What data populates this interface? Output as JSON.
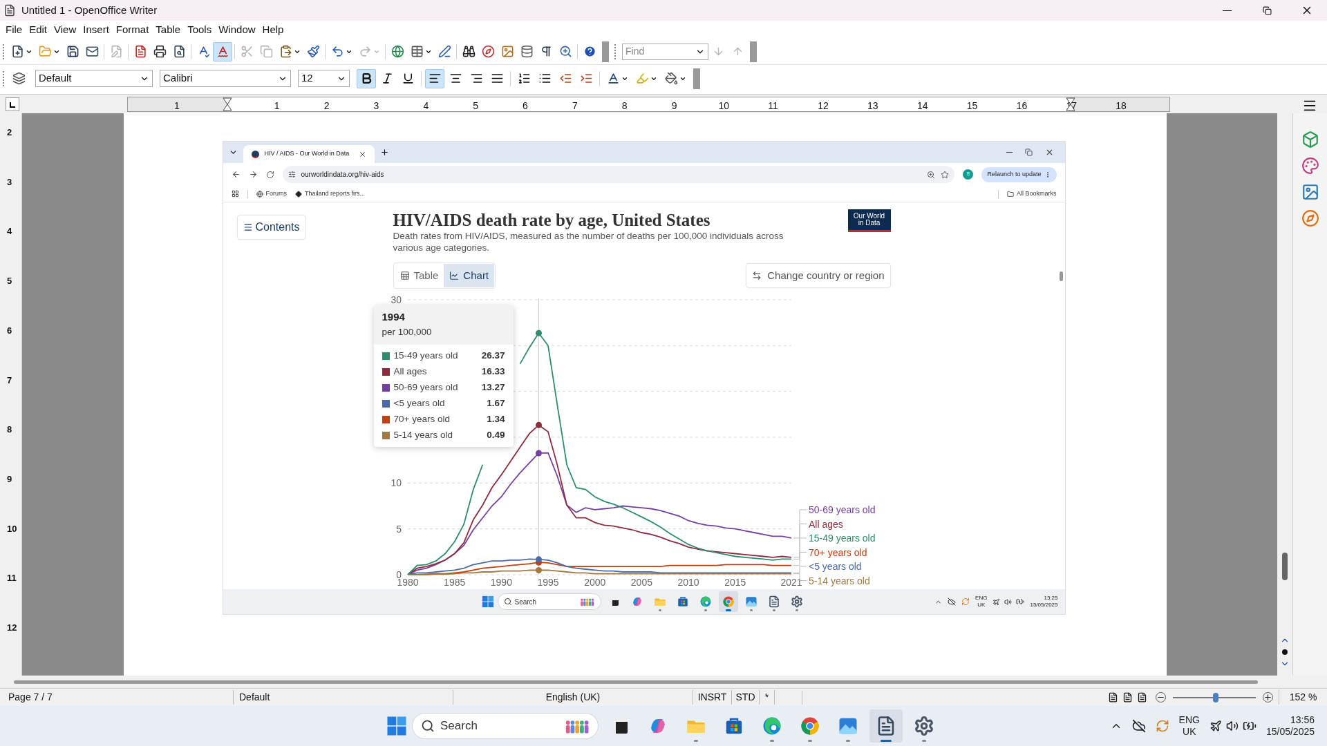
{
  "window": {
    "title": "Untitled 1 - OpenOffice Writer"
  },
  "menu": [
    "File",
    "Edit",
    "View",
    "Insert",
    "Format",
    "Table",
    "Tools",
    "Window",
    "Help"
  ],
  "find": {
    "placeholder": "Find"
  },
  "toggles": {
    "auto_spellcheck": true,
    "bold": true,
    "italic": false,
    "underline": false,
    "align_left": true,
    "align_center": false,
    "align_right": false,
    "justify": false
  },
  "disabled": {
    "edit_file": true,
    "cut": true,
    "copy": true,
    "redo": true,
    "find_next": true,
    "find_previous": true
  },
  "formatting": {
    "paragraph_style": "Default",
    "font_name": "Calibri",
    "font_size": "12"
  },
  "ruler": {
    "left_label": "1",
    "labels": [
      "1",
      "2",
      "3",
      "4",
      "5",
      "6",
      "7",
      "8",
      "9",
      "10",
      "11",
      "12",
      "13",
      "14",
      "15",
      "16",
      "17",
      "18"
    ]
  },
  "vertical_ruler": [
    "2",
    "3",
    "4",
    "5",
    "6",
    "7",
    "8",
    "9",
    "10",
    "11",
    "12"
  ],
  "browser": {
    "tab_title": "HIV / AIDS - Our World in Data",
    "url": "ourworldindata.org/hiv-aids",
    "profile": "S",
    "relaunch": "Relaunch to update",
    "bookmarks": [
      "Forums",
      "Thailand reports firs..."
    ],
    "all_bookmarks": "All Bookmarks"
  },
  "article": {
    "contents": "Contents",
    "title": "HIV/AIDS death rate by age, United States",
    "description": "Death rates from HIV/AIDS, measured as the number of deaths per 100,000 individuals across various age categories.",
    "logo": [
      "Our World",
      "in Data"
    ],
    "view_tabs": [
      {
        "label": "Table",
        "selected": false
      },
      {
        "label": "Chart",
        "selected": true
      }
    ],
    "change_country": "Change country or region",
    "tooltip": {
      "year": "1994",
      "unit": "per 100,000",
      "rows": [
        {
          "label": "15-49 years old",
          "value": "26.37",
          "color": "#2e8b6e"
        },
        {
          "label": "All ages",
          "value": "16.33",
          "color": "#8c2b3e"
        },
        {
          "label": "50-69 years old",
          "value": "13.27",
          "color": "#7440a0"
        },
        {
          "label": "<5 years old",
          "value": "1.67",
          "color": "#4a6aa8"
        },
        {
          "label": "70+ years old",
          "value": "1.34",
          "color": "#c0400f"
        },
        {
          "label": "5-14 years old",
          "value": "0.49",
          "color": "#a07840"
        }
      ]
    },
    "chart_data": {
      "type": "line",
      "xlim": [
        1980,
        2021
      ],
      "ylim": [
        0,
        30
      ],
      "xticks": [
        1980,
        1985,
        1990,
        1995,
        2000,
        2005,
        2010,
        2015,
        2021
      ],
      "yticks": [
        0,
        5,
        10,
        30
      ],
      "ref_lines": [
        {
          "axis": "x",
          "value": 1994
        }
      ],
      "x": [
        1980,
        1981,
        1982,
        1983,
        1984,
        1985,
        1986,
        1987,
        1988,
        1989,
        1990,
        1991,
        1992,
        1993,
        1994,
        1995,
        1996,
        1997,
        1998,
        1999,
        2000,
        2001,
        2002,
        2003,
        2004,
        2005,
        2006,
        2007,
        2008,
        2009,
        2010,
        2011,
        2012,
        2013,
        2014,
        2015,
        2016,
        2017,
        2018,
        2019,
        2020,
        2021
      ],
      "series": [
        {
          "name": "50-69 years old",
          "color": "#7440a0",
          "values": [
            0,
            0.5,
            0.7,
            1.1,
            1.6,
            2.3,
            3.2,
            4.9,
            6.2,
            7.5,
            8.5,
            9.9,
            11.1,
            12.2,
            13.27,
            13.3,
            10.7,
            7.6,
            6.8,
            7.3,
            7.1,
            7.2,
            7.3,
            7.5,
            7.4,
            7.3,
            7.2,
            7.0,
            6.7,
            6.4,
            5.9,
            5.6,
            5.4,
            5.3,
            5.1,
            5.0,
            4.8,
            4.6,
            4.4,
            4.2,
            4.2,
            4.0
          ]
        },
        {
          "name": "All ages",
          "color": "#8c2b3e",
          "values": [
            0,
            0.7,
            0.9,
            1.2,
            1.6,
            2.3,
            3.5,
            6.0,
            7.6,
            9.5,
            10.9,
            12.4,
            13.9,
            15.4,
            16.33,
            15.6,
            11.9,
            7.6,
            6.2,
            6.2,
            5.7,
            5.4,
            5.3,
            5.1,
            4.9,
            4.6,
            4.4,
            4.1,
            3.7,
            3.4,
            3.0,
            2.8,
            2.6,
            2.5,
            2.4,
            2.3,
            2.2,
            2.1,
            2.0,
            1.9,
            2.0,
            1.9
          ]
        },
        {
          "name": "15-49 years old",
          "color": "#2e8b6e",
          "values": [
            0,
            1.0,
            1.1,
            1.5,
            2.3,
            3.6,
            5.5,
            9.3,
            12.0,
            null,
            null,
            null,
            23.0,
            24.8,
            26.37,
            25.0,
            18.4,
            12.0,
            9.5,
            9.3,
            8.5,
            8.0,
            7.7,
            7.3,
            6.8,
            6.3,
            5.8,
            5.2,
            4.5,
            3.9,
            3.3,
            2.9,
            2.6,
            2.4,
            2.2,
            2.0,
            1.9,
            1.8,
            1.7,
            1.6,
            1.7,
            1.7
          ]
        },
        {
          "name": "70+ years old",
          "color": "#c0400f",
          "values": [
            0,
            0,
            0.05,
            0.1,
            0.1,
            0.2,
            0.3,
            0.5,
            0.7,
            0.8,
            0.9,
            1.0,
            1.1,
            1.2,
            1.34,
            1.3,
            1.1,
            0.9,
            0.9,
            0.9,
            0.9,
            0.9,
            0.9,
            0.9,
            0.9,
            0.9,
            0.9,
            0.9,
            1.0,
            1.0,
            1.0,
            1.0,
            1.0,
            1.0,
            1.1,
            1.1,
            1.1,
            1.1,
            1.1,
            1.0,
            1.0,
            1.0
          ]
        },
        {
          "name": "<5 years old",
          "color": "#4a6aa8",
          "values": [
            0,
            0.2,
            0.2,
            0.3,
            0.4,
            0.5,
            0.7,
            1.1,
            1.3,
            1.5,
            1.5,
            1.6,
            1.6,
            1.7,
            1.67,
            1.6,
            1.3,
            0.9,
            0.7,
            0.6,
            0.5,
            0.4,
            0.4,
            0.3,
            0.3,
            0.3,
            0.3,
            0.2,
            0.2,
            0.2,
            0.2,
            0.2,
            0.2,
            0.2,
            0.2,
            0.2,
            0.2,
            0.2,
            0.2,
            0.2,
            0.2,
            0.2
          ]
        },
        {
          "name": "5-14 years old",
          "color": "#a07840",
          "values": [
            0,
            0,
            0,
            0.05,
            0.05,
            0.1,
            0.2,
            0.2,
            0.3,
            0.3,
            0.4,
            0.4,
            0.4,
            0.5,
            0.49,
            0.5,
            0.4,
            0.3,
            0.2,
            0.2,
            0.1,
            0.1,
            0.1,
            0.1,
            0.1,
            0.1,
            0.1,
            0.1,
            0.1,
            0.1,
            0.1,
            0.1,
            0.1,
            0.1,
            0.1,
            0.1,
            0.1,
            0.1,
            0.1,
            0.1,
            0.1,
            0.1
          ]
        }
      ]
    }
  },
  "inner_taskbar": {
    "search": "Search",
    "lang": [
      "ENG",
      "UK"
    ],
    "time": "13:25",
    "date": "15/05/2025",
    "apps": [
      {
        "kind": "taskview",
        "running": false,
        "active": false
      },
      {
        "kind": "copilot",
        "running": false,
        "active": false
      },
      {
        "kind": "explorer",
        "running": true,
        "active": false
      },
      {
        "kind": "store",
        "running": false,
        "active": false
      },
      {
        "kind": "edge",
        "running": true,
        "active": false
      },
      {
        "kind": "chrome",
        "running": true,
        "active": true
      },
      {
        "kind": "photos",
        "running": true,
        "active": false
      },
      {
        "kind": "writer",
        "running": true,
        "active": false
      },
      {
        "kind": "settings",
        "running": true,
        "active": false
      }
    ]
  },
  "status_bar": {
    "page": "Page 7 / 7",
    "style": "Default",
    "language": "English (UK)",
    "insert_mode": "INSRT",
    "selection_mode": "STD",
    "modified": "*",
    "zoom": "152 %",
    "zoom_slider": {
      "level": 0.52
    }
  },
  "taskbar": {
    "search": "Search",
    "lang": [
      "ENG",
      "UK"
    ],
    "time": "13:56",
    "date": "15/05/2025",
    "apps": [
      {
        "kind": "taskview",
        "running": false,
        "active": false
      },
      {
        "kind": "copilot",
        "running": false,
        "active": false
      },
      {
        "kind": "explorer",
        "running": true,
        "active": false
      },
      {
        "kind": "store",
        "running": false,
        "active": false
      },
      {
        "kind": "edge",
        "running": true,
        "active": false
      },
      {
        "kind": "chrome",
        "running": true,
        "active": false
      },
      {
        "kind": "photos",
        "running": true,
        "active": false
      },
      {
        "kind": "writer",
        "running": true,
        "active": true
      },
      {
        "kind": "settings",
        "running": true,
        "active": false
      }
    ]
  }
}
